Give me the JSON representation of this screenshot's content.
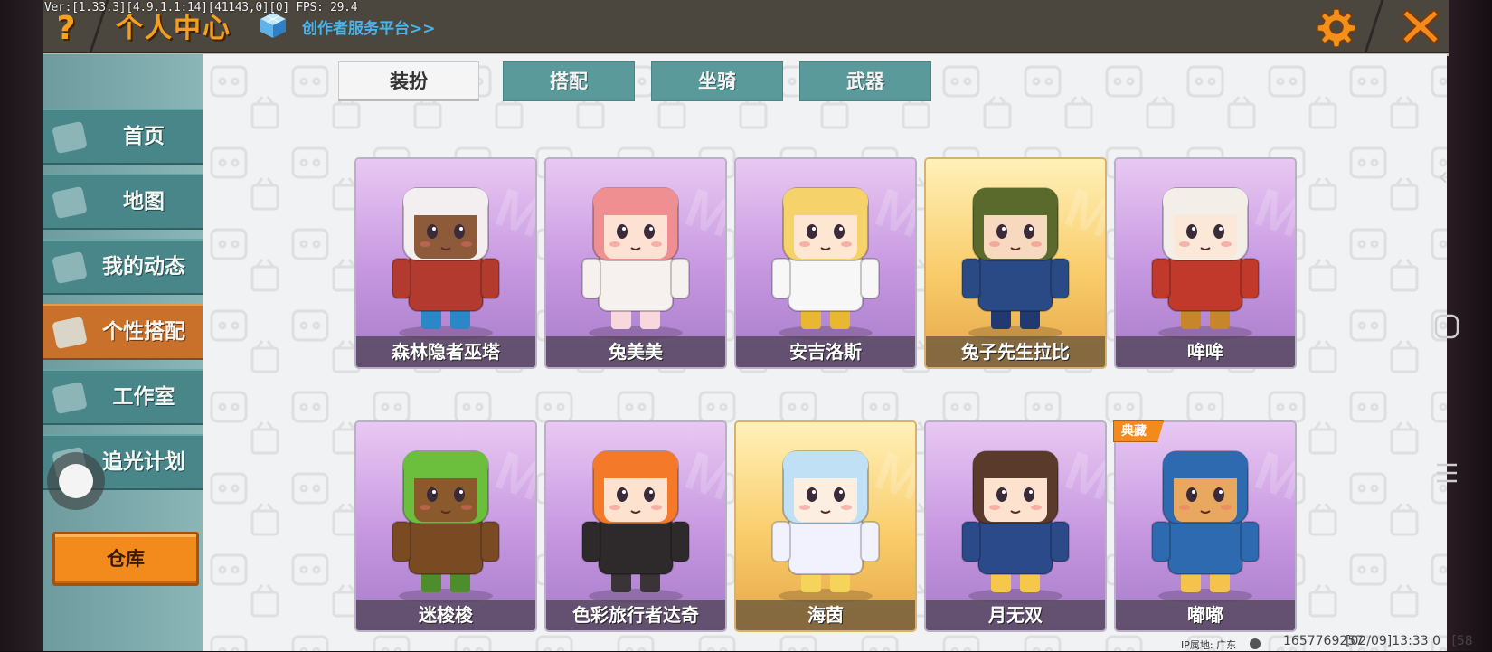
{
  "debug_info": "Ver:[1.33.3][4.9.1.1:14][41143,0][0] FPS: 29.4",
  "header": {
    "help_label": "?",
    "title": "个人中心",
    "creator_link": "创作者服务平台>>"
  },
  "sidebar": {
    "items": [
      {
        "label": "首页",
        "active": false
      },
      {
        "label": "地图",
        "active": false
      },
      {
        "label": "我的动态",
        "active": false
      },
      {
        "label": "个性搭配",
        "active": true
      },
      {
        "label": "工作室",
        "active": false
      },
      {
        "label": "追光计划",
        "active": false
      }
    ],
    "warehouse_label": "仓库"
  },
  "tabs": [
    {
      "label": "装扮",
      "active": true
    },
    {
      "label": "搭配",
      "active": false
    },
    {
      "label": "坐骑",
      "active": false
    },
    {
      "label": "武器",
      "active": false
    }
  ],
  "skins": [
    {
      "name": "森林隐者巫塔",
      "bg": "purple",
      "hair": "#f3eef0",
      "skin": "#8d5a3a",
      "outfit": "#b23a2e",
      "accent": "#2a88c8"
    },
    {
      "name": "兔美美",
      "bg": "purple",
      "hair": "#ef8f92",
      "skin": "#fde2d4",
      "outfit": "#f6f1ee",
      "accent": "#f8d8dc"
    },
    {
      "name": "安吉洛斯",
      "bg": "purple",
      "hair": "#f5d26a",
      "skin": "#fde6d2",
      "outfit": "#f7f7f7",
      "accent": "#e8b830"
    },
    {
      "name": "兔子先生拉比",
      "bg": "gold",
      "hair": "#5a6a2c",
      "skin": "#f7d9c0",
      "outfit": "#2a4a86",
      "accent": "#1e3a70"
    },
    {
      "name": "哞哞",
      "bg": "purple",
      "hair": "#f3efe8",
      "skin": "#fbe8d8",
      "outfit": "#c0392b",
      "accent": "#c7862a"
    },
    {
      "name": "迷梭梭",
      "bg": "purple",
      "hair": "#6cbf3c",
      "skin": "#8a5a2c",
      "outfit": "#7a4a22",
      "accent": "#4e8e2a"
    },
    {
      "name": "色彩旅行者达奇",
      "bg": "purple",
      "hair": "#f47a2a",
      "skin": "#fde2d0",
      "outfit": "#2e2a2c",
      "accent": "#3a3436"
    },
    {
      "name": "海茵",
      "bg": "gold",
      "hair": "#bfe0f5",
      "skin": "#fdeee2",
      "outfit": "#f2f2ff",
      "accent": "#f5d45a"
    },
    {
      "name": "月无双",
      "bg": "purple",
      "hair": "#5a3a2a",
      "skin": "#fde2d0",
      "outfit": "#2a4a8a",
      "accent": "#f5c84a"
    },
    {
      "name": "嘟嘟",
      "bg": "purple",
      "hair": "#2e6ab0",
      "skin": "#e8a860",
      "outfit": "#2e6ab0",
      "accent": "#f5c24a"
    }
  ],
  "collector_tag": "典藏",
  "footer": {
    "ip_location": "IP属地: 广东",
    "uid": "1657769257",
    "timestamp": "[02/09]13:33 0",
    "extra": "[58"
  },
  "colors": {
    "header_bg": "#4b463e",
    "title_orange": "#f3a020",
    "teal": "#49868a",
    "active_orange": "#c9712a",
    "link_blue": "#47b5ea"
  }
}
